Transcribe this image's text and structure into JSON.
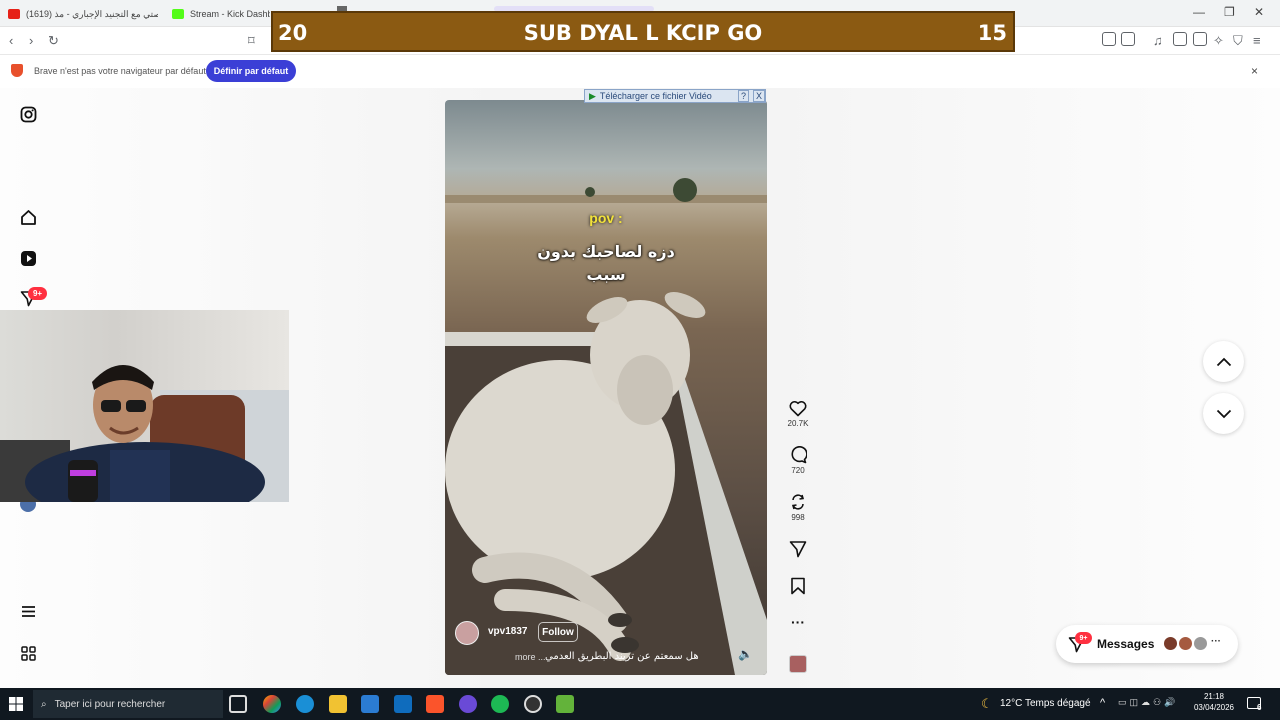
{
  "browser": {
    "tabs": [
      {
        "label": "(1619) قصتي مع التجنيد الإجباري - مذ...",
        "favicon": "youtube-icon"
      },
      {
        "label": "Stream - Kick Dashboa",
        "favicon": "kick-icon"
      }
    ]
  },
  "banner": {
    "text": "Brave n'est pas votre navigateur par défaut",
    "button": "Définir par défaut",
    "close": "×"
  },
  "overlay": {
    "left_number": "20",
    "title": "SUB DYAL L KCIP GO",
    "right_number": "15"
  },
  "sidebar": {
    "notification_badge": "9+"
  },
  "video": {
    "download_label": "Télécharger ce fichier Vidéo",
    "download_help": "?",
    "download_close": "X",
    "caption_pov": "pov :",
    "caption_line1": "دزه لصاحبك بدون",
    "caption_line2": "سبب",
    "username": "vpv1837",
    "follow": "Follow",
    "description": "هل سمعتم عن تريند البطريق العدمي",
    "more": "more ..."
  },
  "actions": {
    "likes": "20.7K",
    "comments": "720",
    "reposts": "998",
    "more": "···"
  },
  "messages": {
    "label": "Messages",
    "badge": "9+",
    "more": "···"
  },
  "taskbar": {
    "search_placeholder": "Taper ici pour rechercher",
    "weather": "12°C  Temps dégagé",
    "time": "21:18",
    "date": "03/04/2026",
    "notification_count": "6"
  }
}
